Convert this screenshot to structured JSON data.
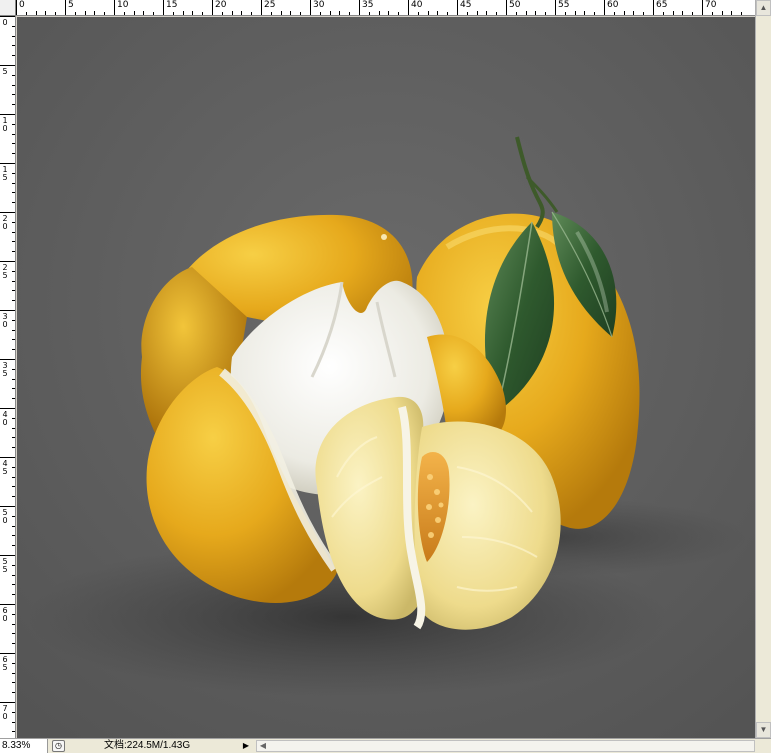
{
  "rulers": {
    "top_labels": [
      "0",
      "5",
      "10",
      "15",
      "20",
      "25",
      "30",
      "35",
      "40",
      "45",
      "50",
      "55",
      "60",
      "65",
      "70"
    ],
    "left_labels": [
      "0",
      "5",
      "1\n0",
      "1\n5",
      "2\n0",
      "2\n5",
      "3\n0",
      "3\n5",
      "4\n0",
      "4\n5",
      "5\n0",
      "5\n5",
      "6\n0",
      "6\n5",
      "7\n0"
    ]
  },
  "status": {
    "zoom": "8.33%",
    "doc_info": "文档:224.5M/1.43G"
  },
  "colors": {
    "canvas_bg": "#606060",
    "pomelo_yellow": "#e8b020",
    "leaf_green": "#3c6e3a",
    "flesh_cream": "#f3e6a8"
  },
  "icons": {
    "doc_status": "document-status-icon",
    "expand": "triangle-right-icon",
    "scroll_left": "scroll-left-arrow-icon",
    "scroll_up": "scroll-up-arrow-icon",
    "scroll_down": "scroll-down-arrow-icon"
  }
}
